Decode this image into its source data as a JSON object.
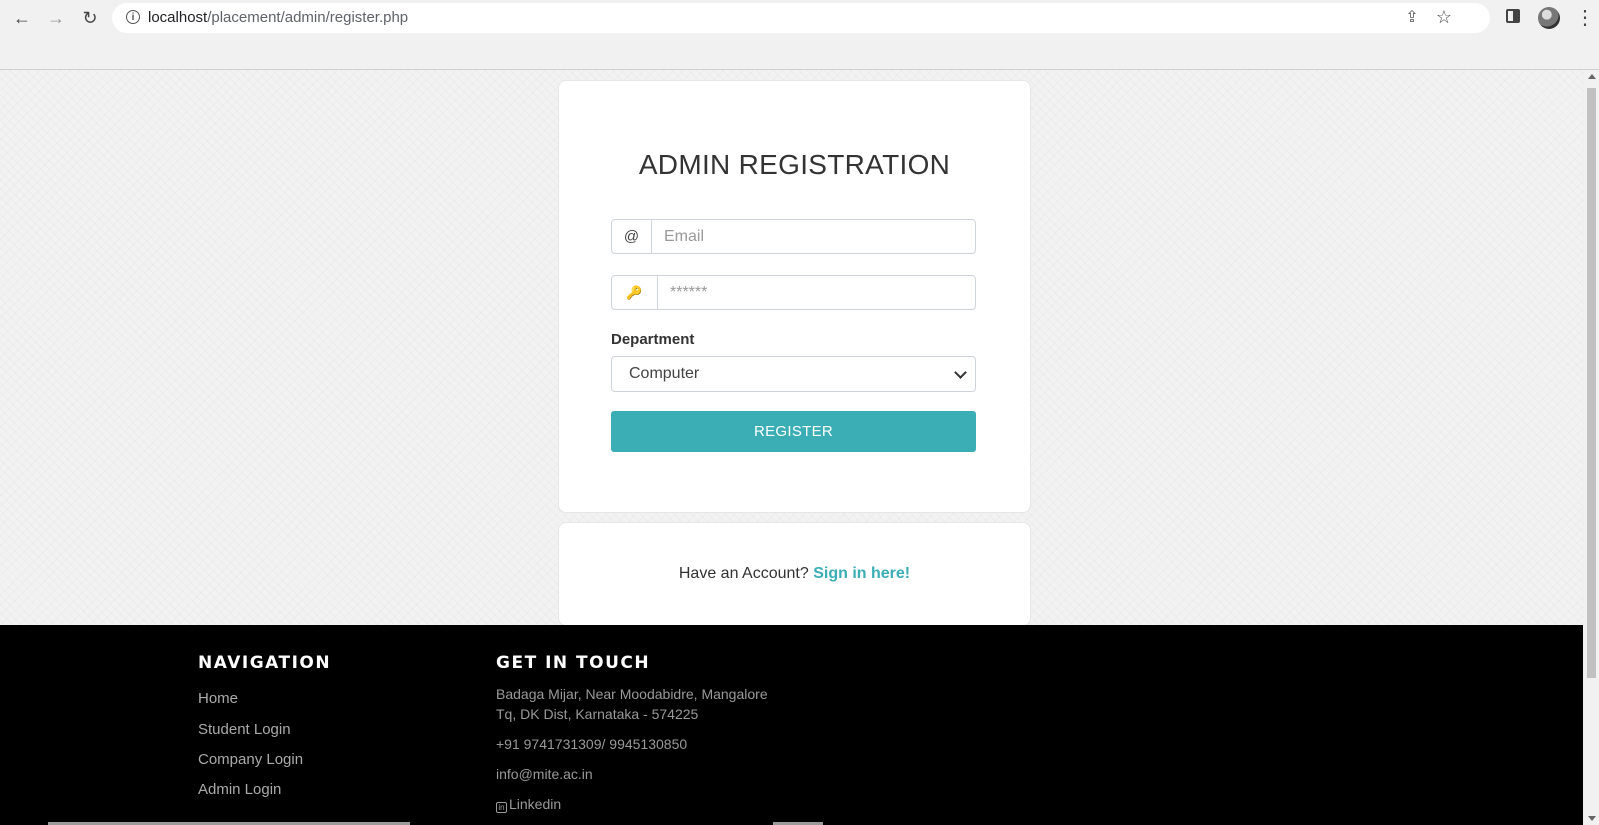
{
  "browser": {
    "url_host": "localhost",
    "url_path": "/placement/admin/register.php",
    "back_icon": "←",
    "forward_icon": "→",
    "reload_icon": "↻",
    "info_icon": "i",
    "share_icon": "⇪",
    "star_icon": "☆",
    "menu_icon": "⋮"
  },
  "form": {
    "title": "ADMIN REGISTRATION",
    "email_addon": "@",
    "email_placeholder": "Email",
    "password_addon": "🔑",
    "password_placeholder": "******",
    "department_label": "Department",
    "department_value": "Computer",
    "register_label": "REGISTER"
  },
  "signin": {
    "prompt": "Have an Account?",
    "link": "Sign in here!"
  },
  "footer": {
    "navigation_title": "NAVIGATION",
    "nav_links": [
      "Home",
      "Student Login",
      "Company Login",
      "Admin Login"
    ],
    "contact_title": "GET IN TOUCH",
    "address_line1": "Badaga Mijar, Near Moodabidre, Mangalore",
    "address_line2": "Tq, DK Dist, Karnataka - 574225",
    "phone": "+91 9741731309/ 9945130850",
    "email": "info@mite.ac.in",
    "linkedin": "Linkedin"
  },
  "colors": {
    "accent": "#3aadb5",
    "footer_bg": "#000000"
  }
}
